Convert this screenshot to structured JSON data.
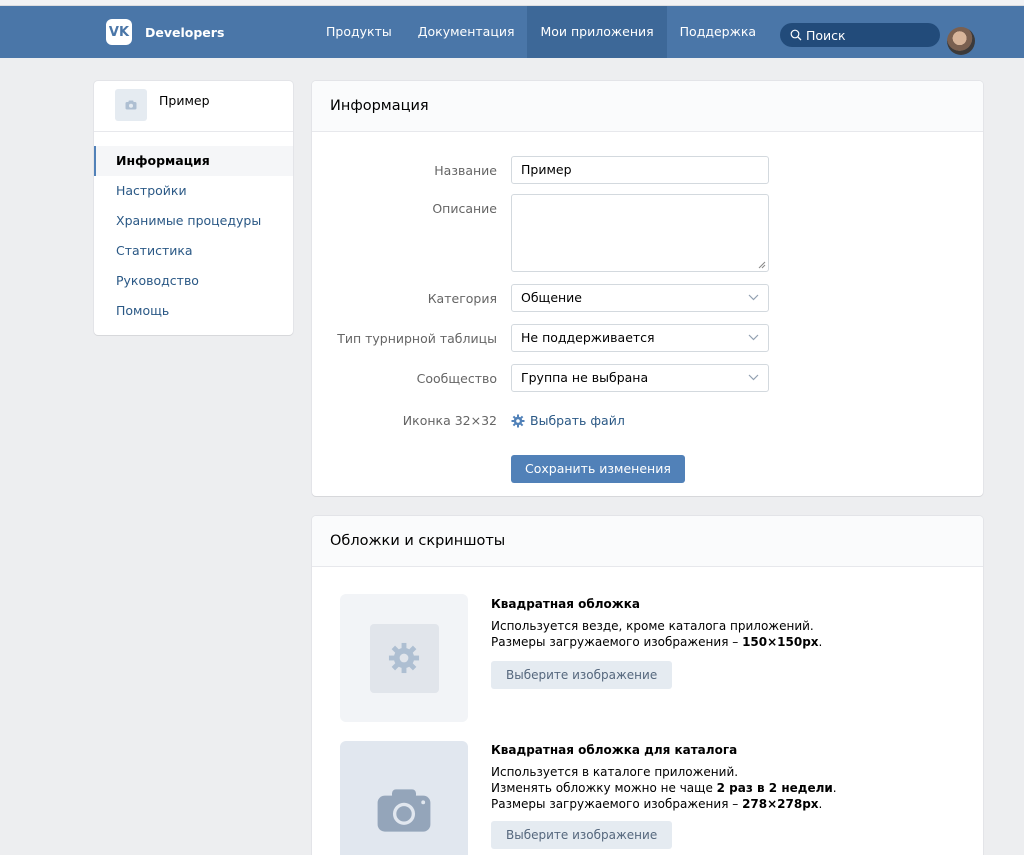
{
  "header": {
    "brand": "Developers",
    "logo_text": "VK",
    "nav": [
      "Продукты",
      "Документация",
      "Мои приложения",
      "Поддержка"
    ],
    "active_nav": 2,
    "search_placeholder": "Поиск",
    "colors": {
      "header_bg": "#4a76a8",
      "active_bg": "#3d6898",
      "accent": "#5181b8",
      "link": "#2a5885"
    }
  },
  "sidebar": {
    "app_name": "Пример",
    "items": [
      {
        "label": "Информация",
        "active": true
      },
      {
        "label": "Настройки"
      },
      {
        "label": "Хранимые процедуры"
      },
      {
        "label": "Статистика"
      },
      {
        "label": "Руководство"
      },
      {
        "label": "Помощь"
      }
    ]
  },
  "info": {
    "title": "Информация",
    "name_label": "Название",
    "name_value": "Пример",
    "desc_label": "Описание",
    "desc_value": "",
    "category_label": "Категория",
    "category_value": "Общение",
    "table_label": "Тип турнирной таблицы",
    "table_value": "Не поддерживается",
    "community_label": "Сообщество",
    "community_value": "Группа не выбрана",
    "icon_label": "Иконка 32×32",
    "choose_file": "Выбрать файл",
    "save": "Сохранить изменения"
  },
  "covers": {
    "title": "Обложки и скриншоты",
    "items": [
      {
        "title": "Квадратная обложка",
        "line1": "Используется везде, кроме каталога приложений.",
        "line2_prefix": "Размеры загружаемого изображения – ",
        "line2_bold": "150×150px",
        "line2_suffix": ".",
        "button": "Выберите изображение",
        "icon": "gear-icon"
      },
      {
        "title": "Квадратная обложка для каталога",
        "line1": "Используется в каталоге приложений.",
        "line2_prefix": "Изменять обложку можно не чаще ",
        "line2_bold": "2 раз в 2 недели",
        "line2_suffix": ".",
        "line3_prefix": "Размеры загружаемого изображения – ",
        "line3_bold": "278×278px",
        "line3_suffix": ".",
        "button": "Выберите изображение",
        "icon": "camera-icon"
      }
    ]
  }
}
